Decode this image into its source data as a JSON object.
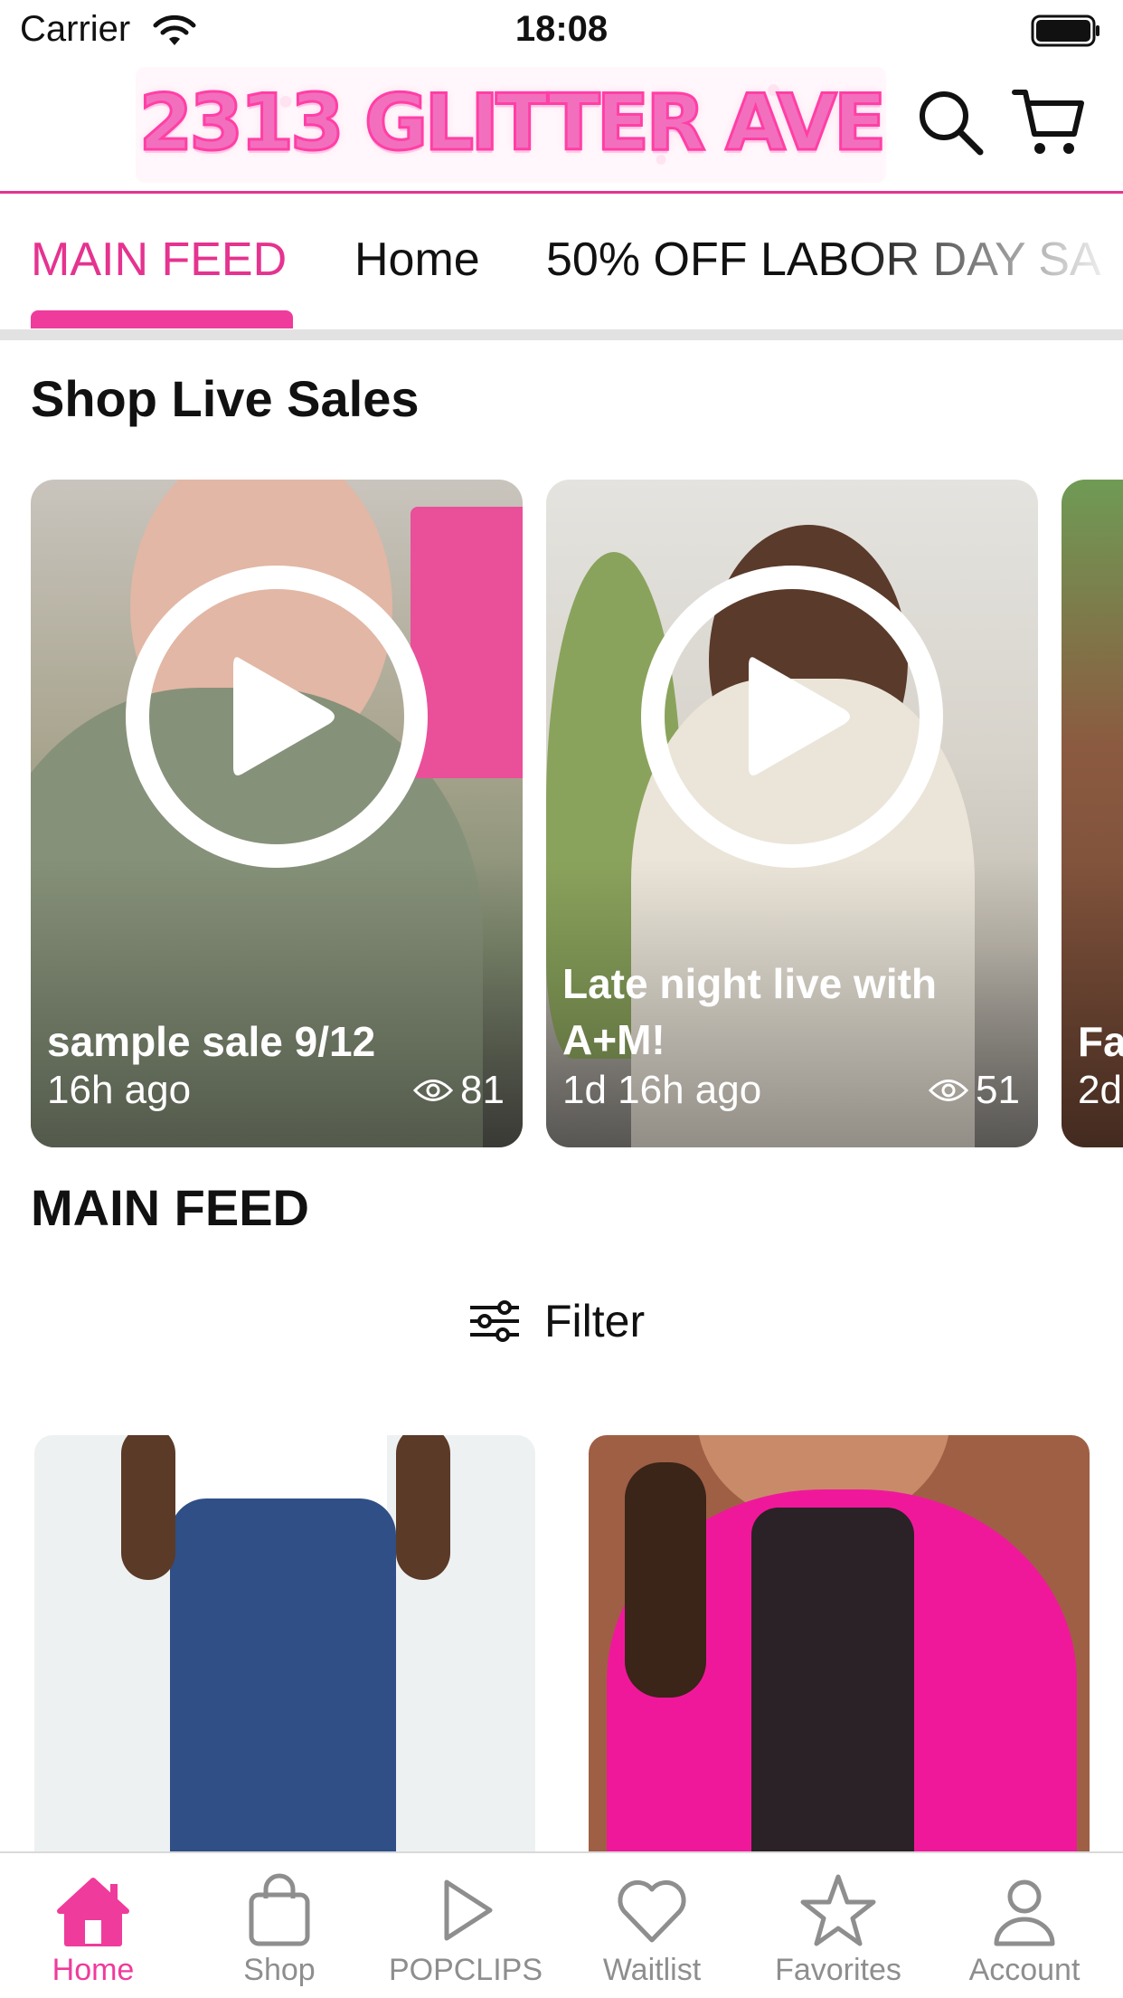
{
  "status_bar": {
    "carrier": "Carrier",
    "time": "18:08"
  },
  "header": {
    "logo_text": "2313 GLITTER AVE"
  },
  "tabs": [
    {
      "label": "MAIN FEED",
      "active": true
    },
    {
      "label": "Home",
      "active": false
    },
    {
      "label": "50% OFF LABOR DAY SA",
      "active": false
    }
  ],
  "live_section": {
    "title": "Shop Live Sales",
    "cards": [
      {
        "name": "sample sale 9/12",
        "time": "16h ago",
        "views": "81"
      },
      {
        "name": "Late night live with A+M!",
        "time": "1d 16h ago",
        "views": "51"
      },
      {
        "name": "Fa",
        "time": "2d",
        "views": ""
      }
    ]
  },
  "feed": {
    "title": "MAIN FEED",
    "filter_label": "Filter"
  },
  "bottom_nav": [
    {
      "label": "Home",
      "icon": "home-icon",
      "active": true
    },
    {
      "label": "Shop",
      "icon": "shopping-bag-icon",
      "active": false
    },
    {
      "label": "POPCLIPS",
      "icon": "play-icon",
      "active": false
    },
    {
      "label": "Waitlist",
      "icon": "heart-icon",
      "active": false
    },
    {
      "label": "Favorites",
      "icon": "star-icon",
      "active": false
    },
    {
      "label": "Account",
      "icon": "person-icon",
      "active": false
    }
  ],
  "colors": {
    "accent": "#ef3b9c",
    "inactive": "#8e8e8e",
    "divider": "#e2e2e2"
  }
}
